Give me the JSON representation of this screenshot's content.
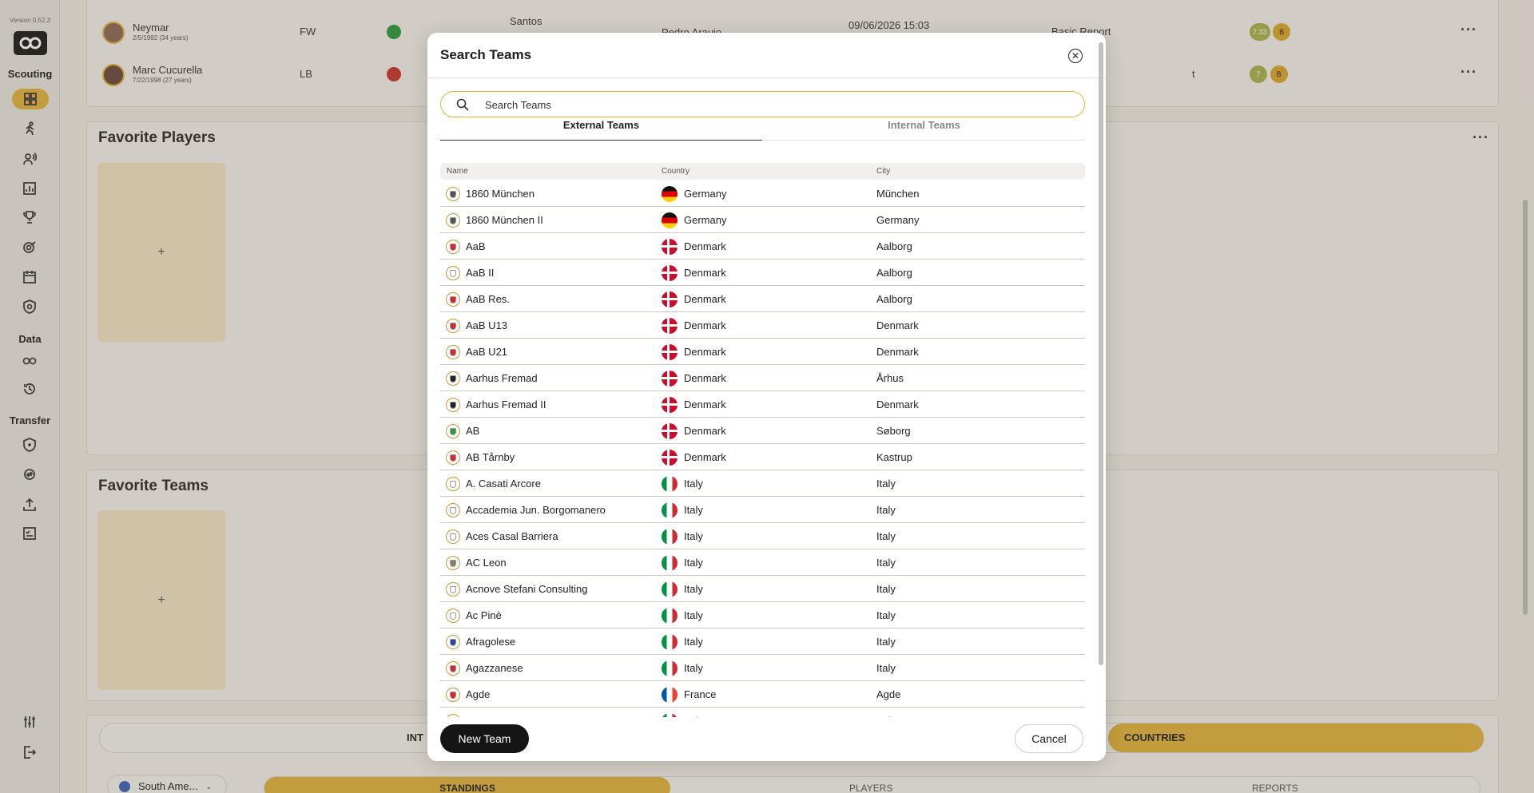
{
  "app": {
    "version": "Version 0.52.3",
    "sections": [
      "Scouting",
      "Data",
      "Transfer"
    ]
  },
  "sidebar_icons": [
    "dashboard-icon",
    "player-icon",
    "scout-icon",
    "report-icon",
    "trophy-icon",
    "target-icon",
    "calendar-icon",
    "shield-icon",
    "data-icon",
    "history-icon",
    "transfer-shield-icon",
    "exchange-icon",
    "upload-icon",
    "checklist-icon",
    "settings-icon",
    "logout-icon"
  ],
  "background": {
    "players": [
      {
        "name": "Neymar",
        "dob": "2/5/1992 (34 years)",
        "position": "FW",
        "team": "Santos",
        "scout": "Pedro Araujo",
        "date": "09/06/2026 15:03",
        "report": "Basic Report",
        "rating": "7.33",
        "grade": "B"
      },
      {
        "name": "Marc Cucurella",
        "dob": "7/22/1998 (27 years)",
        "position": "LB",
        "team": "",
        "scout": "",
        "date": "",
        "report": "t",
        "rating": "7",
        "grade": "B"
      }
    ],
    "favorite_players_title": "Favorite Players",
    "favorite_teams_title": "Favorite Teams",
    "add_symbol": "+",
    "bottom_left_label": "INT",
    "bottom_right_label": "COUNTRIES",
    "region_label": "South Ame...",
    "bottom_tabs": [
      "STANDINGS",
      "PLAYERS",
      "REPORTS"
    ]
  },
  "modal": {
    "title": "Search Teams",
    "search_placeholder": "Search Teams",
    "tabs": [
      {
        "label": "External Teams",
        "active": true
      },
      {
        "label": "Internal Teams",
        "active": false
      }
    ],
    "columns": [
      "Name",
      "Country",
      "City"
    ],
    "rows": [
      {
        "name": "1860 München",
        "country": "Germany",
        "city": "München",
        "flag": "de",
        "crest": "lion"
      },
      {
        "name": "1860 München II",
        "country": "Germany",
        "city": "Germany",
        "flag": "de",
        "crest": "lion"
      },
      {
        "name": "AaB",
        "country": "Denmark",
        "city": "Aalborg",
        "flag": "dk",
        "crest": "red"
      },
      {
        "name": "AaB II",
        "country": "Denmark",
        "city": "Aalborg",
        "flag": "dk",
        "crest": "blank"
      },
      {
        "name": "AaB Res.",
        "country": "Denmark",
        "city": "Aalborg",
        "flag": "dk",
        "crest": "red"
      },
      {
        "name": "AaB U13",
        "country": "Denmark",
        "city": "Denmark",
        "flag": "dk",
        "crest": "red"
      },
      {
        "name": "AaB U21",
        "country": "Denmark",
        "city": "Denmark",
        "flag": "dk",
        "crest": "red"
      },
      {
        "name": "Aarhus Fremad",
        "country": "Denmark",
        "city": "Århus",
        "flag": "dk",
        "crest": "black"
      },
      {
        "name": "Aarhus Fremad II",
        "country": "Denmark",
        "city": "Denmark",
        "flag": "dk",
        "crest": "black"
      },
      {
        "name": "AB",
        "country": "Denmark",
        "city": "Søborg",
        "flag": "dk",
        "crest": "green"
      },
      {
        "name": "AB Tårnby",
        "country": "Denmark",
        "city": "Kastrup",
        "flag": "dk",
        "crest": "red"
      },
      {
        "name": "A. Casati Arcore",
        "country": "Italy",
        "city": "Italy",
        "flag": "it",
        "crest": "blank"
      },
      {
        "name": "Accademia Jun. Borgomanero",
        "country": "Italy",
        "city": "Italy",
        "flag": "it",
        "crest": "blank"
      },
      {
        "name": "Aces Casal Barriera",
        "country": "Italy",
        "city": "Italy",
        "flag": "it",
        "crest": "blank"
      },
      {
        "name": "AC Leon",
        "country": "Italy",
        "city": "Italy",
        "flag": "it",
        "crest": "grey"
      },
      {
        "name": "Acnove Stefani Consulting",
        "country": "Italy",
        "city": "Italy",
        "flag": "it",
        "crest": "blank"
      },
      {
        "name": "Ac Pinè",
        "country": "Italy",
        "city": "Italy",
        "flag": "it",
        "crest": "blank"
      },
      {
        "name": "Afragolese",
        "country": "Italy",
        "city": "Italy",
        "flag": "it",
        "crest": "blue"
      },
      {
        "name": "Agazzanese",
        "country": "Italy",
        "city": "Italy",
        "flag": "it",
        "crest": "red"
      },
      {
        "name": "Agde",
        "country": "France",
        "city": "Agde",
        "flag": "fr",
        "crest": "redwhite"
      },
      {
        "name": "A...",
        "country": "Ital...",
        "city": "Ital...",
        "flag": "it",
        "crest": "blank"
      }
    ],
    "new_team_label": "New Team",
    "cancel_label": "Cancel"
  },
  "colors": {
    "accent": "#e0b23c",
    "dark_button": "#151515"
  }
}
